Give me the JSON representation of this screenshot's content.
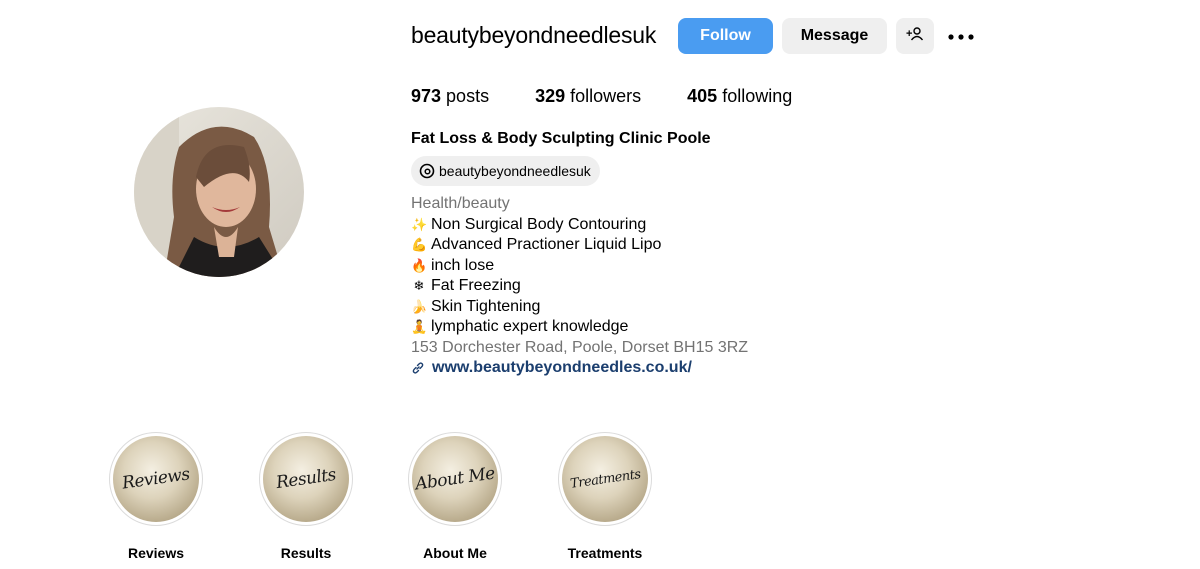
{
  "profile": {
    "username": "beautybeyondneedlesuk",
    "follow_label": "Follow",
    "message_label": "Message",
    "add_user_icon": "add-user-icon",
    "more_icon": "more-options-icon"
  },
  "stats": {
    "posts_count": "973",
    "posts_label": " posts",
    "followers_count": "329",
    "followers_label": " followers",
    "following_count": "405",
    "following_label": " following"
  },
  "bio": {
    "full_name": "Fat Loss & Body Sculpting Clinic Poole",
    "threads_handle": "beautybeyondneedlesuk",
    "category": "Health/beauty",
    "lines": [
      {
        "emoji": "✨",
        "text": "Non Surgical Body Contouring"
      },
      {
        "emoji": "💪",
        "text": "Advanced Practioner Liquid Lipo"
      },
      {
        "emoji": "🔥",
        "text": "inch lose"
      },
      {
        "emoji": "❄",
        "text": "Fat Freezing"
      },
      {
        "emoji": "🍌",
        "text": "Skin Tightening"
      },
      {
        "emoji": "🧘",
        "text": "lymphatic expert knowledge"
      }
    ],
    "address": "153 Dorchester Road, Poole, Dorset BH15 3RZ",
    "website": "www.beautybeyondneedles.co.uk/"
  },
  "highlights": [
    {
      "label": "Reviews",
      "cover_text": "Reviews"
    },
    {
      "label": "Results",
      "cover_text": "Results"
    },
    {
      "label": "About Me",
      "cover_text": "About Me"
    },
    {
      "label": "Treatments",
      "cover_text": "Treatments"
    }
  ],
  "colors": {
    "follow_button": "#4a9cf1",
    "secondary_button": "#efefef",
    "link": "#1b3e6e",
    "muted_text": "#737373"
  }
}
